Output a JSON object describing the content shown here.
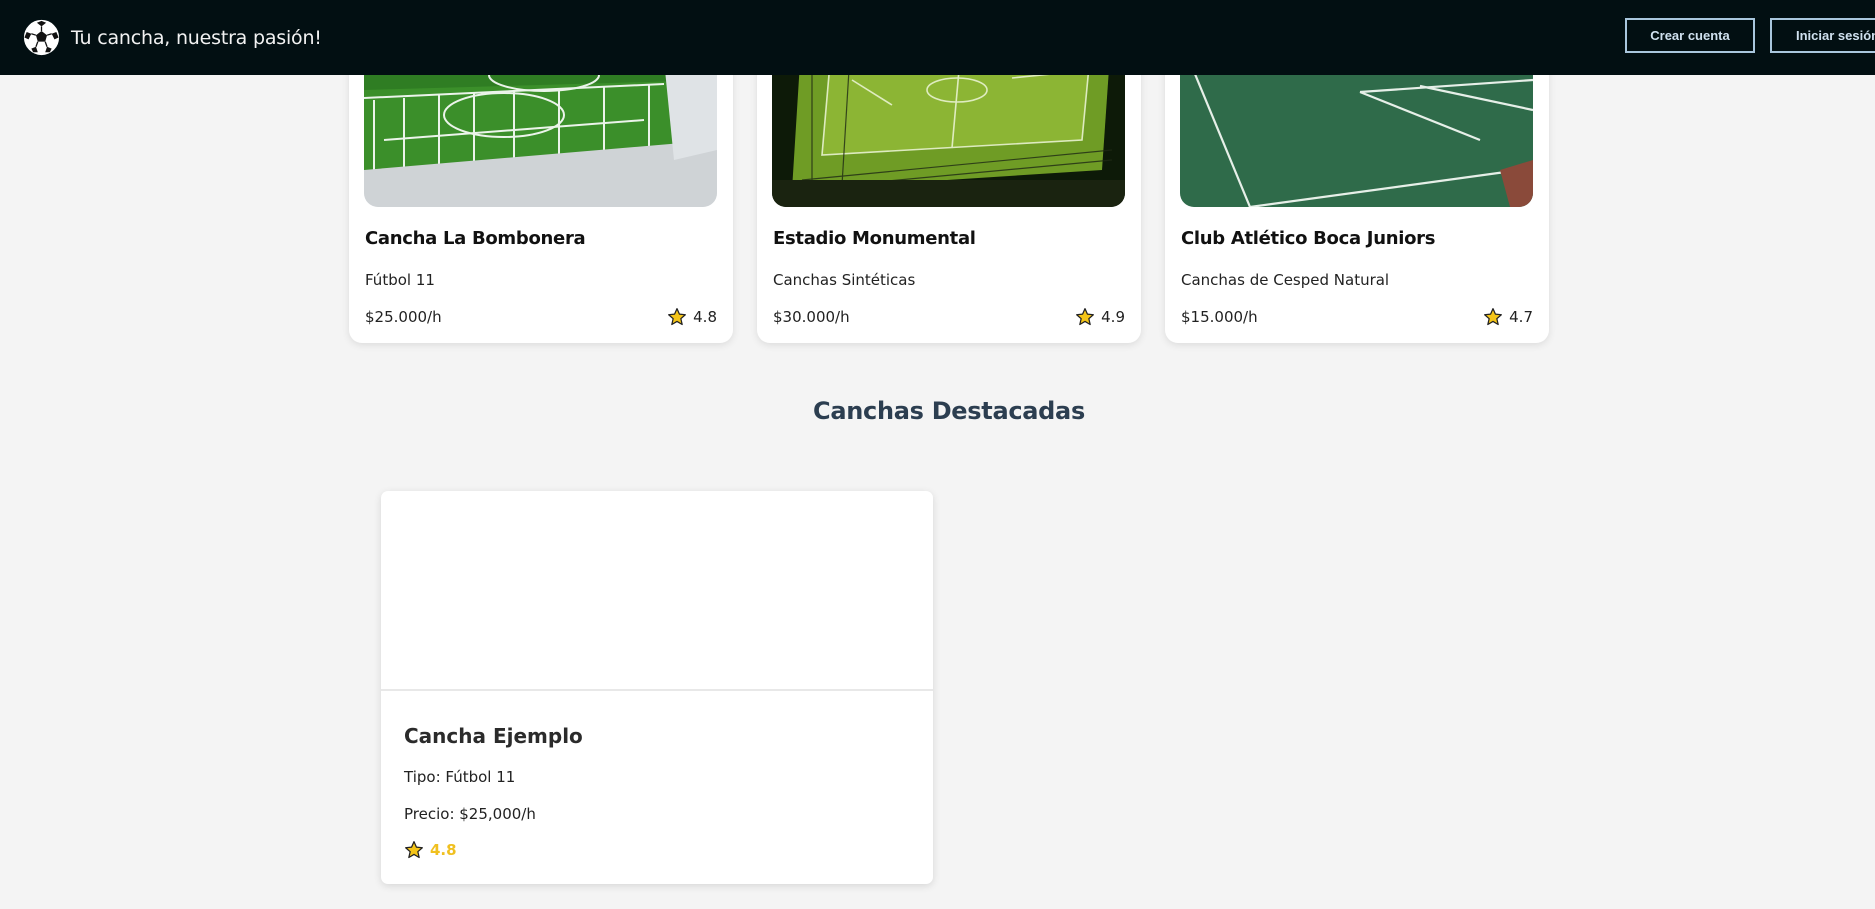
{
  "header": {
    "brand": "Tu cancha, nuestra pasión!",
    "logo_icon": "soccer-ball-icon",
    "create_account": "Crear cuenta",
    "login": "Iniciar sesión"
  },
  "fields": [
    {
      "name": "Cancha La Bombonera",
      "type": "Fútbol 11",
      "price": "$25.000/h",
      "rating": "4.8"
    },
    {
      "name": "Estadio Monumental",
      "type": "Canchas Sintéticas",
      "price": "$30.000/h",
      "rating": "4.9"
    },
    {
      "name": "Club Atlético Boca Juniors",
      "type": "Canchas de Cesped Natural",
      "price": "$15.000/h",
      "rating": "4.7"
    }
  ],
  "featured": {
    "heading": "Canchas Destacadas",
    "items": [
      {
        "name": "Cancha Ejemplo",
        "type": "Tipo: Fútbol 11",
        "price": "Precio: $25,000/h",
        "rating": "4.8"
      }
    ]
  },
  "colors": {
    "topbar": "#020f12",
    "button_border": "#a9c6dd",
    "heading": "#2c3e50",
    "rating_accent": "#f0c020",
    "star_fill": "#f5c518"
  }
}
